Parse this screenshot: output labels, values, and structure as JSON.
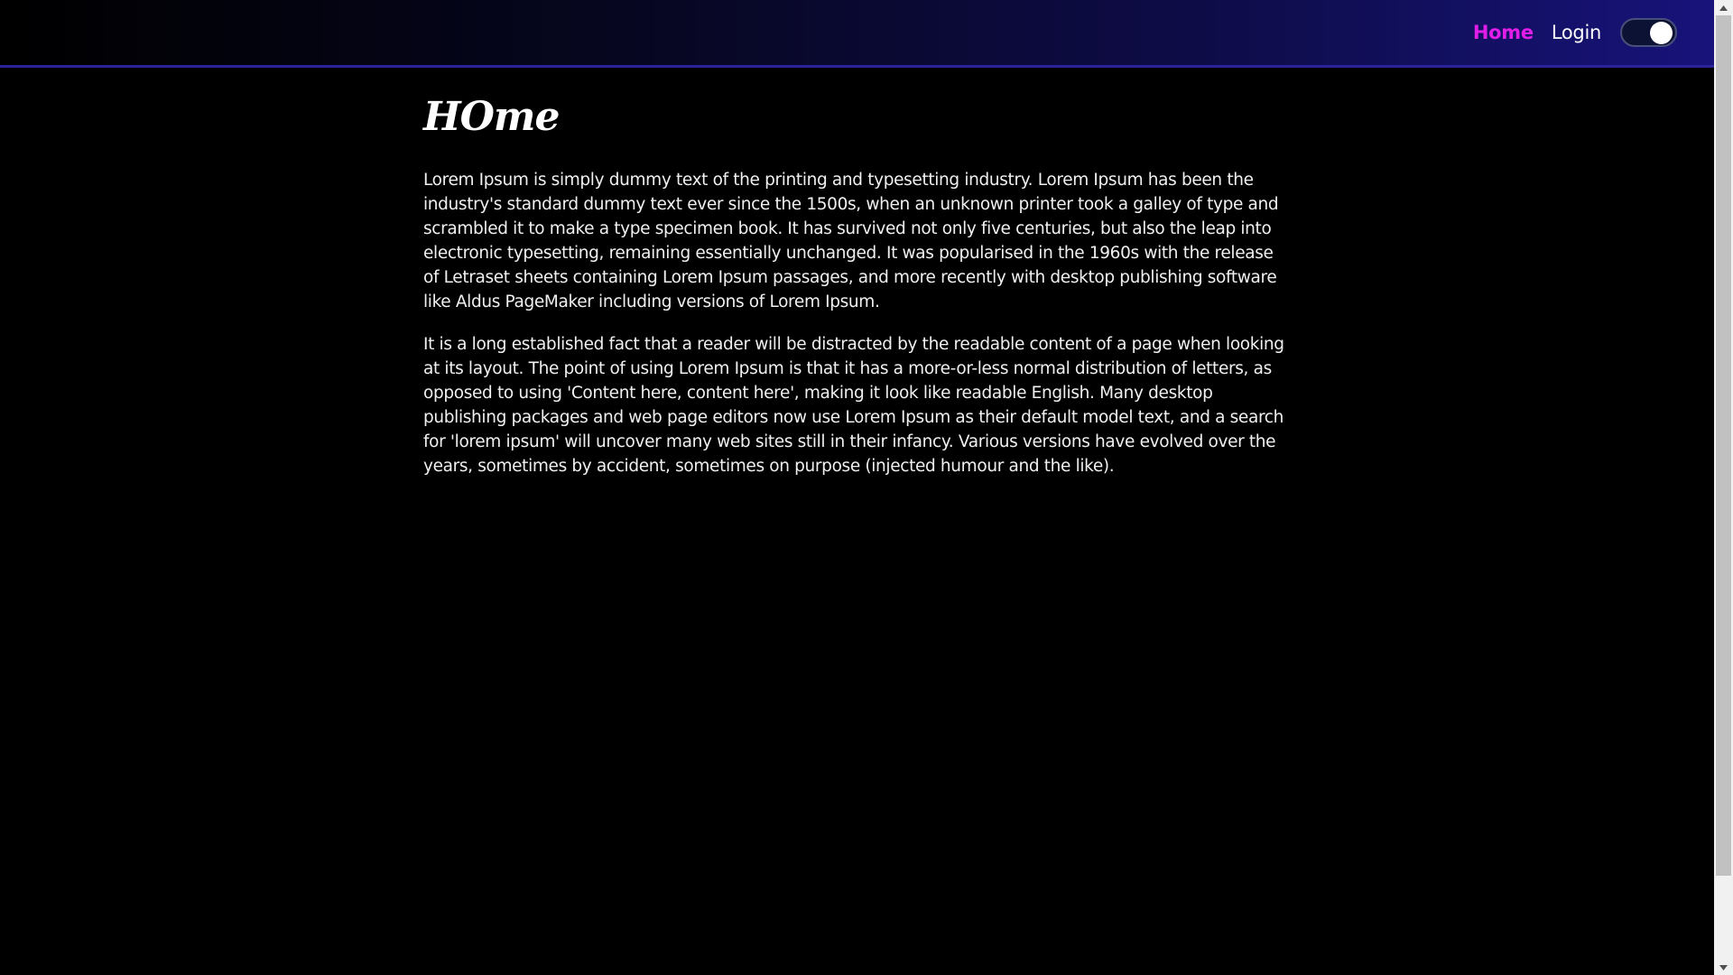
{
  "nav": {
    "home_label": "Home",
    "login_label": "Login",
    "theme_toggle_on": true
  },
  "main": {
    "title": "HOme",
    "paragraphs": [
      "Lorem Ipsum is simply dummy text of the printing and typesetting industry. Lorem Ipsum has been the industry's standard dummy text ever since the 1500s, when an unknown printer took a galley of type and scrambled it to make a type specimen book. It has survived not only five centuries, but also the leap into electronic typesetting, remaining essentially unchanged. It was popularised in the 1960s with the release of Letraset sheets containing Lorem Ipsum passages, and more recently with desktop publishing software like Aldus PageMaker including versions of Lorem Ipsum.",
      "It is a long established fact that a reader will be distracted by the readable content of a page when looking at its layout. The point of using Lorem Ipsum is that it has a more-or-less normal distribution of letters, as opposed to using 'Content here, content here', making it look like readable English. Many desktop publishing packages and web page editors now use Lorem Ipsum as their default model text, and a search for 'lorem ipsum' will uncover many web sites still in their infancy. Various versions have evolved over the years, sometimes by accident, sometimes on purpose (injected humour and the like)."
    ]
  },
  "colors": {
    "background": "#000000",
    "active_link": "#e11ee8",
    "navbar_accent": "#17137a",
    "text": "#f0f0f0"
  },
  "icons": {
    "scroll_up": "chevron-up-icon",
    "scroll_down": "chevron-down-icon"
  }
}
